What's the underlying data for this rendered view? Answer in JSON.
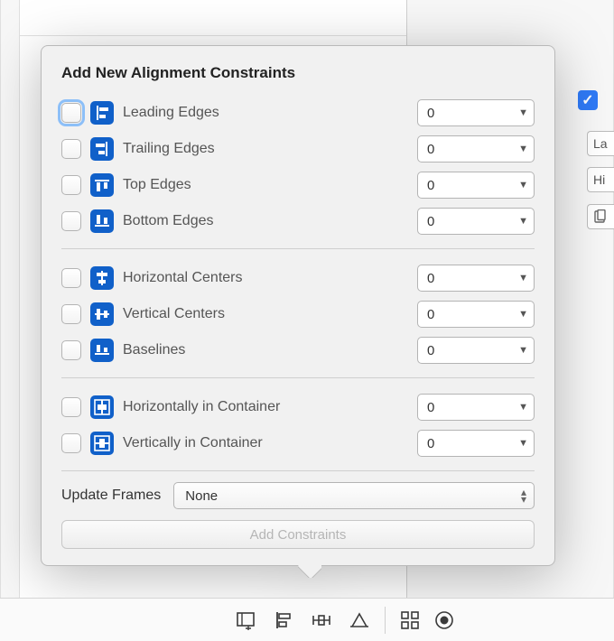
{
  "title": "Add New Alignment Constraints",
  "groups": [
    {
      "items": [
        {
          "id": "leading-edges",
          "label": "Leading Edges",
          "value": "0",
          "focused": true
        },
        {
          "id": "trailing-edges",
          "label": "Trailing Edges",
          "value": "0"
        },
        {
          "id": "top-edges",
          "label": "Top Edges",
          "value": "0"
        },
        {
          "id": "bottom-edges",
          "label": "Bottom Edges",
          "value": "0"
        }
      ]
    },
    {
      "items": [
        {
          "id": "horizontal-centers",
          "label": "Horizontal Centers",
          "value": "0"
        },
        {
          "id": "vertical-centers",
          "label": "Vertical Centers",
          "value": "0"
        },
        {
          "id": "baselines",
          "label": "Baselines",
          "value": "0"
        }
      ]
    },
    {
      "items": [
        {
          "id": "horizontally-in-container",
          "label": "Horizontally in Container",
          "value": "0"
        },
        {
          "id": "vertically-in-container",
          "label": "Vertically in Container",
          "value": "0"
        }
      ]
    }
  ],
  "update_frames": {
    "label": "Update Frames",
    "value": "None"
  },
  "add_button": "Add Constraints",
  "bg": {
    "stub1": "La",
    "stub2": "Hi"
  }
}
